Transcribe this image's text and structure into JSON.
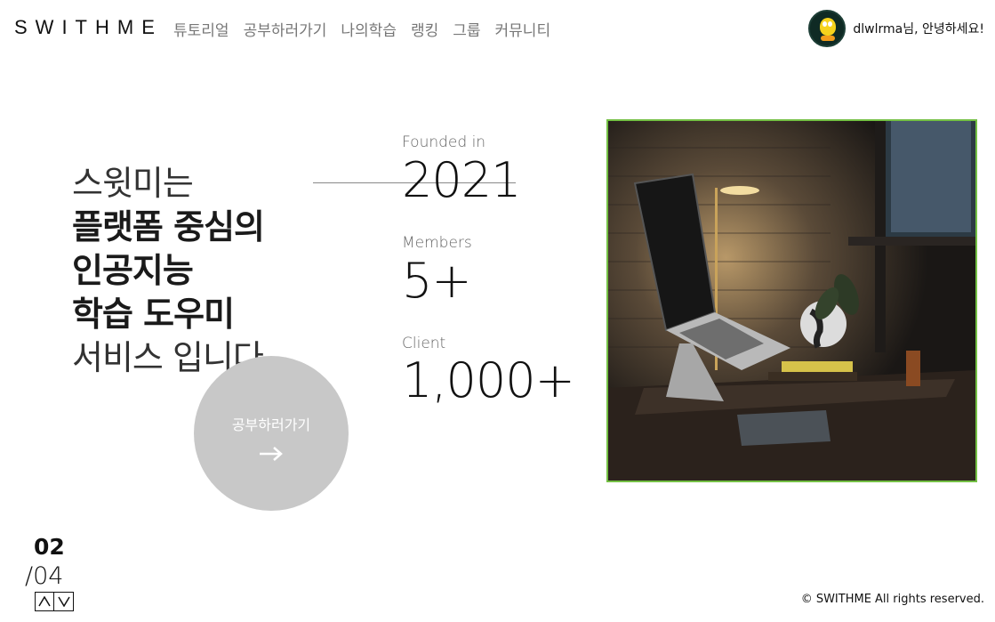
{
  "brand": {
    "logo": "SWITHME"
  },
  "nav": {
    "items": [
      {
        "label": "튜토리얼"
      },
      {
        "label": "공부하러가기"
      },
      {
        "label": "나의학습"
      },
      {
        "label": "랭킹"
      },
      {
        "label": "그룹"
      },
      {
        "label": "커뮤니티"
      }
    ]
  },
  "user": {
    "greeting": "dlwlrma님, 안녕하세요!",
    "avatar_icon": "tweety-avatar-icon"
  },
  "hero": {
    "line1": "스윗미는",
    "line2": "플랫폼 중심의",
    "line3": "인공지능",
    "line4": "학습 도우미",
    "line5": "서비스 입니다."
  },
  "stats": [
    {
      "label": "Founded in",
      "value": "2021"
    },
    {
      "label": "Members",
      "value": "5+"
    },
    {
      "label": "Client",
      "value": "1,000+"
    }
  ],
  "cta": {
    "label": "공부하러가기",
    "icon": "arrow-right-icon"
  },
  "pager": {
    "current": "02",
    "total": "/04"
  },
  "footer": {
    "copyright": "© SWITHME All rights reserved."
  },
  "colors": {
    "photo_border": "#74c044",
    "cta_bg": "#c8c8c8",
    "nav_text": "#777777"
  }
}
